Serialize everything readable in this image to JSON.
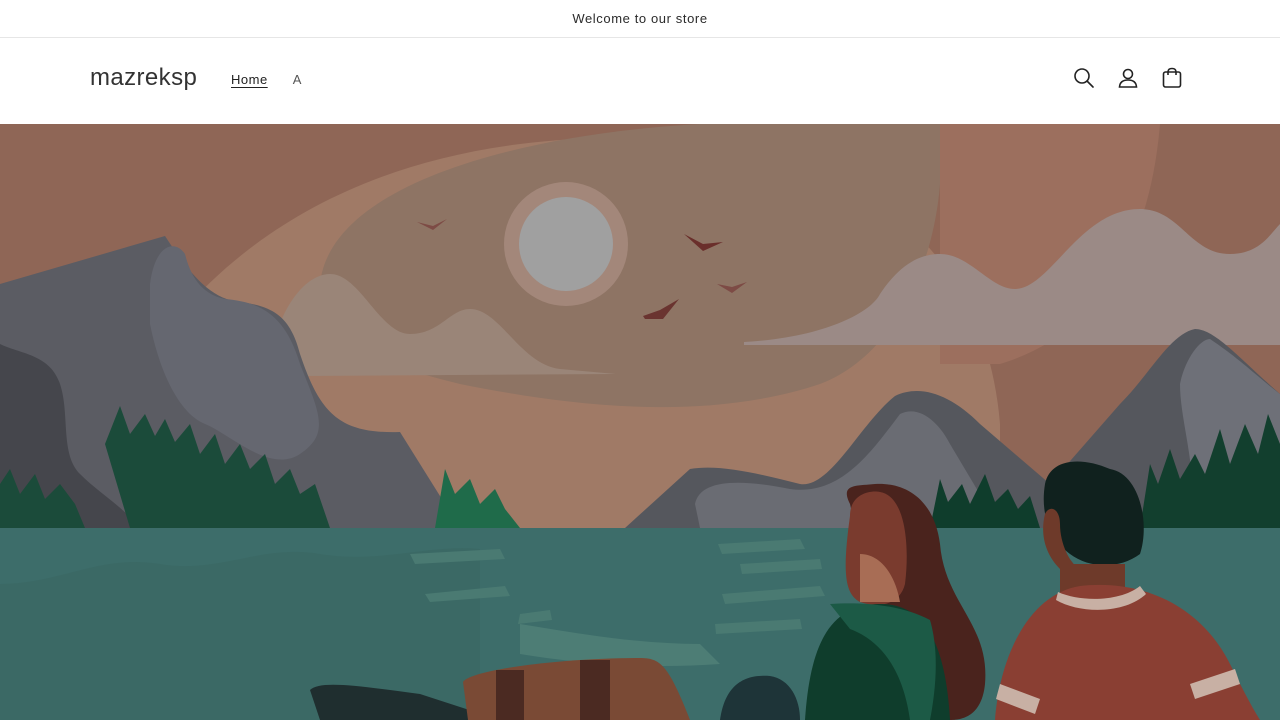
{
  "announcement": {
    "text": "Welcome to our store"
  },
  "header": {
    "logo": "mazreksp",
    "nav": [
      {
        "label": "Home",
        "active": true
      },
      {
        "label": "A",
        "active": false
      }
    ],
    "icons": [
      "search-icon",
      "account-icon",
      "cart-icon"
    ]
  },
  "hero": {
    "image": "illustration-couple-lake-mountains-sunset"
  },
  "colors": {
    "sky": "#8f6656",
    "water": "#3d6d6a",
    "mountain": "#5a5c62",
    "tree": "#1b4b3a",
    "cloud": "#9a8a86"
  }
}
